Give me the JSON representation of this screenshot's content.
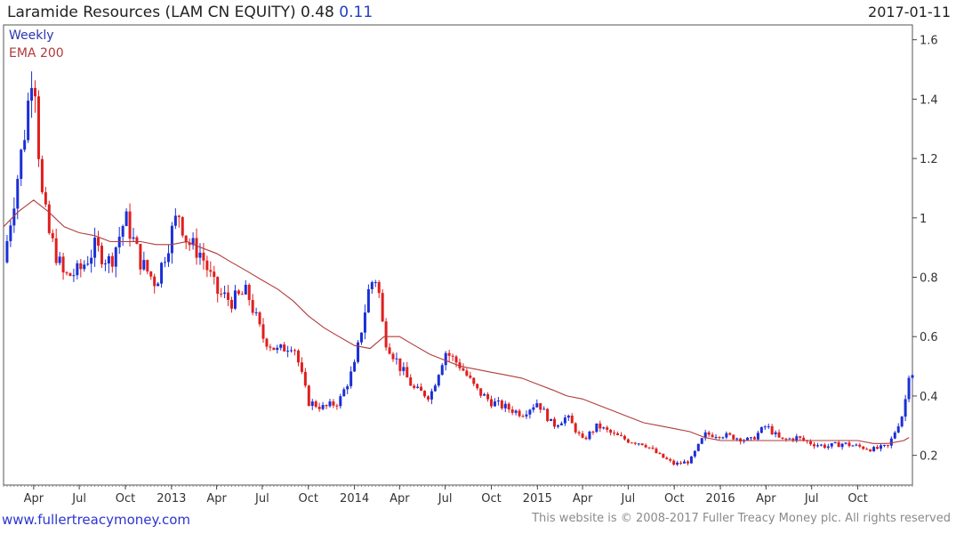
{
  "header": {
    "title": "Laramide Resources (LAM CN EQUITY) 0.48",
    "change": "0.11",
    "date": "2017-01-11"
  },
  "legend": {
    "weekly": "Weekly",
    "ema": "EMA 200"
  },
  "footer": {
    "url": "www.fullertreacymoney.com",
    "copyright": "This website is © 2008-2017 Fuller Treacy Money plc. All rights reserved"
  },
  "colors": {
    "up": "#1b2fd6",
    "down": "#e01e1e",
    "ema": "#b23b3b",
    "axis": "#444444",
    "grid": "#e4e4e4"
  },
  "chart_data": {
    "type": "line",
    "ylim": [
      0.1,
      1.65
    ],
    "yticks": [
      0.2,
      0.4,
      0.6,
      0.8,
      1,
      1.2,
      1.4,
      1.6
    ],
    "ytick_labels": [
      "0.2",
      "0.4",
      "0.6",
      "0.8",
      "1",
      "1.2",
      "1.4",
      "1.6"
    ],
    "y_axis_position": "right",
    "grid": false,
    "x_start": "2012-02-01",
    "x_end": "2017-01-18",
    "xticks": [
      {
        "date": "2012-04-01",
        "label": "Apr"
      },
      {
        "date": "2012-07-01",
        "label": "Jul"
      },
      {
        "date": "2012-10-01",
        "label": "Oct"
      },
      {
        "date": "2013-01-01",
        "label": "2013"
      },
      {
        "date": "2013-04-01",
        "label": "Apr"
      },
      {
        "date": "2013-07-01",
        "label": "Jul"
      },
      {
        "date": "2013-10-01",
        "label": "Oct"
      },
      {
        "date": "2014-01-01",
        "label": "2014"
      },
      {
        "date": "2014-04-01",
        "label": "Apr"
      },
      {
        "date": "2014-07-01",
        "label": "Jul"
      },
      {
        "date": "2014-10-01",
        "label": "Oct"
      },
      {
        "date": "2015-01-01",
        "label": "2015"
      },
      {
        "date": "2015-04-01",
        "label": "Apr"
      },
      {
        "date": "2015-07-01",
        "label": "Jul"
      },
      {
        "date": "2015-10-01",
        "label": "Oct"
      },
      {
        "date": "2016-01-01",
        "label": "2016"
      },
      {
        "date": "2016-04-01",
        "label": "Apr"
      },
      {
        "date": "2016-07-01",
        "label": "Jul"
      },
      {
        "date": "2016-10-01",
        "label": "Oct"
      }
    ],
    "series": [
      {
        "name": "Weekly",
        "style": "candlestick",
        "x": [
          "2012-02-01",
          "2012-03-01",
          "2012-03-15",
          "2012-04-01",
          "2012-04-15",
          "2012-05-01",
          "2012-06-01",
          "2012-07-01",
          "2012-08-01",
          "2012-09-01",
          "2012-10-01",
          "2012-11-01",
          "2012-12-01",
          "2013-01-01",
          "2013-01-15",
          "2013-02-01",
          "2013-03-01",
          "2013-04-01",
          "2013-05-01",
          "2013-06-01",
          "2013-07-01",
          "2013-08-01",
          "2013-09-01",
          "2013-10-01",
          "2013-11-01",
          "2013-12-01",
          "2014-01-01",
          "2014-02-01",
          "2014-02-15",
          "2014-03-01",
          "2014-04-01",
          "2014-05-01",
          "2014-06-01",
          "2014-07-01",
          "2014-08-01",
          "2014-09-01",
          "2014-10-01",
          "2014-11-01",
          "2014-12-01",
          "2015-01-01",
          "2015-02-01",
          "2015-03-01",
          "2015-04-01",
          "2015-05-01",
          "2015-06-01",
          "2015-07-01",
          "2015-08-01",
          "2015-09-01",
          "2015-10-01",
          "2015-11-01",
          "2015-12-01",
          "2016-01-01",
          "2016-02-01",
          "2016-03-01",
          "2016-04-01",
          "2016-05-01",
          "2016-06-01",
          "2016-07-01",
          "2016-08-01",
          "2016-09-01",
          "2016-10-01",
          "2016-11-01",
          "2016-12-01",
          "2017-01-01",
          "2017-01-11"
        ],
        "values": [
          0.85,
          1.15,
          1.3,
          1.55,
          1.1,
          0.95,
          0.8,
          0.82,
          0.9,
          0.85,
          1.0,
          0.85,
          0.78,
          0.95,
          1.02,
          0.92,
          0.88,
          0.75,
          0.72,
          0.75,
          0.6,
          0.55,
          0.58,
          0.38,
          0.36,
          0.38,
          0.5,
          0.78,
          0.8,
          0.6,
          0.5,
          0.42,
          0.4,
          0.55,
          0.5,
          0.42,
          0.38,
          0.36,
          0.34,
          0.38,
          0.3,
          0.33,
          0.25,
          0.3,
          0.27,
          0.25,
          0.24,
          0.2,
          0.17,
          0.18,
          0.27,
          0.27,
          0.26,
          0.25,
          0.3,
          0.25,
          0.26,
          0.24,
          0.23,
          0.24,
          0.23,
          0.22,
          0.23,
          0.35,
          0.48
        ]
      },
      {
        "name": "EMA 200",
        "style": "line",
        "x": [
          "2012-02-01",
          "2012-03-01",
          "2012-04-01",
          "2012-05-01",
          "2012-06-01",
          "2012-07-01",
          "2012-08-01",
          "2012-09-01",
          "2012-10-01",
          "2012-11-01",
          "2012-12-01",
          "2013-01-01",
          "2013-02-01",
          "2013-03-01",
          "2013-04-01",
          "2013-05-01",
          "2013-06-01",
          "2013-07-01",
          "2013-08-01",
          "2013-09-01",
          "2013-10-01",
          "2013-11-01",
          "2013-12-01",
          "2014-01-01",
          "2014-02-01",
          "2014-03-01",
          "2014-04-01",
          "2014-05-01",
          "2014-06-01",
          "2014-07-01",
          "2014-08-01",
          "2014-09-01",
          "2014-10-01",
          "2014-11-01",
          "2014-12-01",
          "2015-01-01",
          "2015-02-01",
          "2015-03-01",
          "2015-04-01",
          "2015-05-01",
          "2015-06-01",
          "2015-07-01",
          "2015-08-01",
          "2015-09-01",
          "2015-10-01",
          "2015-11-01",
          "2015-12-01",
          "2016-01-01",
          "2016-02-01",
          "2016-03-01",
          "2016-04-01",
          "2016-05-01",
          "2016-06-01",
          "2016-07-01",
          "2016-08-01",
          "2016-09-01",
          "2016-10-01",
          "2016-11-01",
          "2016-12-01",
          "2017-01-01",
          "2017-01-11"
        ],
        "values": [
          0.97,
          1.02,
          1.06,
          1.02,
          0.97,
          0.95,
          0.94,
          0.92,
          0.92,
          0.92,
          0.91,
          0.91,
          0.92,
          0.9,
          0.88,
          0.85,
          0.82,
          0.79,
          0.76,
          0.72,
          0.67,
          0.63,
          0.6,
          0.57,
          0.56,
          0.6,
          0.6,
          0.57,
          0.54,
          0.52,
          0.5,
          0.49,
          0.48,
          0.47,
          0.46,
          0.44,
          0.42,
          0.4,
          0.39,
          0.37,
          0.35,
          0.33,
          0.31,
          0.3,
          0.29,
          0.28,
          0.26,
          0.25,
          0.25,
          0.25,
          0.25,
          0.25,
          0.25,
          0.25,
          0.25,
          0.25,
          0.25,
          0.24,
          0.24,
          0.25,
          0.26
        ]
      }
    ]
  }
}
